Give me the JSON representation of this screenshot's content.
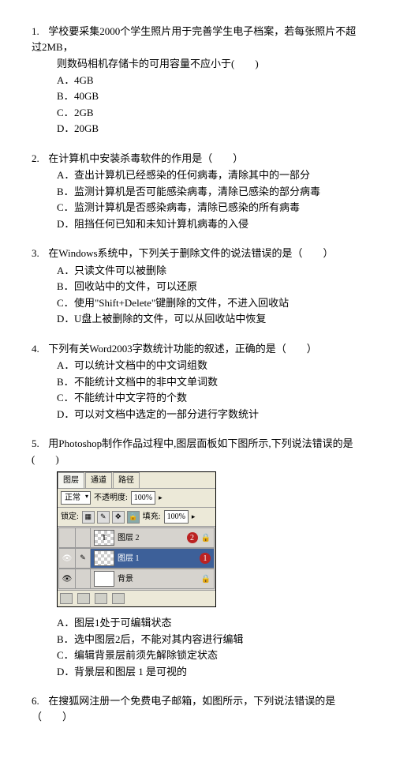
{
  "q1": {
    "num": "1.",
    "text": "学校要采集2000个学生照片用于完善学生电子档案，若每张照片不超过2MB，",
    "text2": "则数码相机存储卡的可用容量不应小于(　　)",
    "a": "A．",
    "av": "4GB",
    "b": "B．",
    "bv": "40GB",
    "c": "C．",
    "cv": "2GB",
    "d": "D．",
    "dv": "20GB"
  },
  "q2": {
    "num": "2.",
    "text": "在计算机中安装杀毒软件的作用是（　　）",
    "a": "A．",
    "av": "查出计算机已经感染的任何病毒，清除其中的一部分",
    "b": "B．",
    "bv": "监测计算机是否可能感染病毒，清除已感染的部分病毒",
    "c": "C．",
    "cv": "监测计算机是否感染病毒，清除已感染的所有病毒",
    "d": "D．",
    "dv": "阻挡任何已知和未知计算机病毒的入侵"
  },
  "q3": {
    "num": "3.",
    "text": "在Windows系统中，下列关于删除文件的说法错误的是（　　）",
    "a": "A．",
    "av": "只读文件可以被删除",
    "b": "B．",
    "bv": "回收站中的文件，可以还原",
    "c": "C．",
    "cv": "使用\"Shift+Delete\"键删除的文件，不进入回收站",
    "d": "D．",
    "dv": "U盘上被删除的文件，可以从回收站中恢复"
  },
  "q4": {
    "num": "4.",
    "text": "下列有关Word2003字数统计功能的叙述，正确的是（　　）",
    "a": "A．",
    "av": "可以统计文档中的中文词组数",
    "b": "B．",
    "bv": "不能统计文档中的非中文单词数",
    "c": "C．",
    "cv": "不能统计中文字符的个数",
    "d": "D．",
    "dv": "可以对文档中选定的一部分进行字数统计"
  },
  "q5": {
    "num": "5.",
    "text": "用Photoshop制作作品过程中,图层面板如下图所示,下列说法错误的是(　　)",
    "a": "A．",
    "av": "图层1处于可编辑状态",
    "b": "B．",
    "bv": "选中图层2后，不能对其内容进行编辑",
    "c": "C．",
    "cv": "编辑背景层前须先解除锁定状态",
    "d": "D．",
    "dv": "背景层和图层 1 是可视的"
  },
  "q6": {
    "num": "6.",
    "text": "在搜狐网注册一个免费电子邮箱，如图所示，下列说法错误的是（　　）"
  },
  "ps": {
    "tab1": "图层",
    "tab2": "通道",
    "tab3": "路径",
    "mode": "正常",
    "opacityLabel": "不透明度:",
    "opacity": "100%",
    "lockLabel": "锁定:",
    "fillLabel": "填充:",
    "fill": "100%",
    "layer2": "图层 2",
    "layer1": "图层 1",
    "layerBg": "背景",
    "num2": "2",
    "num1": "1",
    "lockIcon": "🔒",
    "eye": "👁"
  }
}
